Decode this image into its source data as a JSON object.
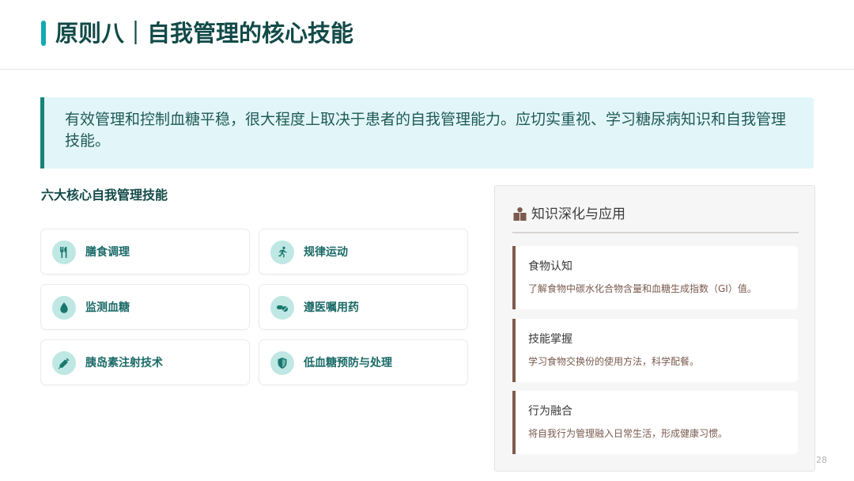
{
  "header": {
    "title": "原则八｜自我管理的核心技能"
  },
  "intro": {
    "text": "有效管理和控制血糖平稳，很大程度上取决于患者的自我管理能力。应切实重视、学习糖尿病知识和自我管理技能。"
  },
  "skills": {
    "title": "六大核心自我管理技能",
    "items": [
      {
        "label": "膳食调理",
        "icon": "utensils-icon"
      },
      {
        "label": "规律运动",
        "icon": "running-icon"
      },
      {
        "label": "监测血糖",
        "icon": "blood-drop-icon"
      },
      {
        "label": "遵医嘱用药",
        "icon": "pills-icon"
      },
      {
        "label": "胰岛素注射技术",
        "icon": "syringe-icon"
      },
      {
        "label": "低血糖预防与处理",
        "icon": "shield-icon"
      }
    ]
  },
  "knowledge": {
    "title": "知识深化与应用",
    "icon": "books-icon",
    "cards": [
      {
        "title": "食物认知",
        "desc": "了解食物中碳水化合物含量和血糖生成指数（GI）值。"
      },
      {
        "title": "技能掌握",
        "desc": "学习食物交换份的使用方法，科学配餐。"
      },
      {
        "title": "行为融合",
        "desc": "将自我行为管理融入日常生活，形成健康习惯。"
      }
    ]
  },
  "page_number": "28",
  "colors": {
    "accent": "#12a9b5",
    "heading": "#124a48",
    "callout_bg": "#e2f6f9",
    "card_border": "#7e5a4d"
  }
}
